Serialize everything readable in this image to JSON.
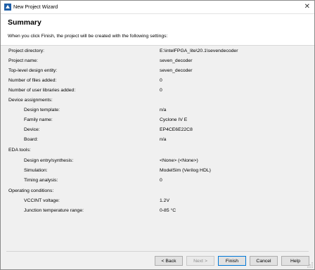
{
  "window": {
    "title": "New Project Wizard"
  },
  "header": {
    "title": "Summary",
    "description": "When you click Finish, the project will be created with the following settings:"
  },
  "settings": [
    {
      "label": "Project directory:",
      "value": "E:\\intelFPGA_lite\\20.1\\sevendecoder",
      "indent": false
    },
    {
      "label": "Project name:",
      "value": "seven_decoder",
      "indent": false
    },
    {
      "label": "Top-level design entity:",
      "value": "seven_decoder",
      "indent": false
    },
    {
      "label": "Number of files added:",
      "value": "0",
      "indent": false
    },
    {
      "label": "Number of user libraries added:",
      "value": "0",
      "indent": false
    },
    {
      "label": "Device assignments:",
      "value": "",
      "indent": false
    },
    {
      "label": "Design template:",
      "value": "n/a",
      "indent": true
    },
    {
      "label": "Family name:",
      "value": "Cyclone IV E",
      "indent": true
    },
    {
      "label": "Device:",
      "value": "EP4CE6E22C8",
      "indent": true
    },
    {
      "label": "Board:",
      "value": "n/a",
      "indent": true
    },
    {
      "label": "EDA tools:",
      "value": "",
      "indent": false
    },
    {
      "label": "Design entry/synthesis:",
      "value": "<None> (<None>)",
      "indent": true
    },
    {
      "label": "Simulation:",
      "value": "ModelSim (Verilog HDL)",
      "indent": true
    },
    {
      "label": "Timing analysis:",
      "value": "0",
      "indent": true
    },
    {
      "label": "Operating conditions:",
      "value": "",
      "indent": false
    },
    {
      "label": "VCCINT voltage:",
      "value": "1.2V",
      "indent": true
    },
    {
      "label": "Junction temperature range:",
      "value": "0-85 °C",
      "indent": true
    }
  ],
  "buttons": {
    "back": "< Back",
    "next": "Next >",
    "finish": "Finish",
    "cancel": "Cancel",
    "help": "Help"
  }
}
